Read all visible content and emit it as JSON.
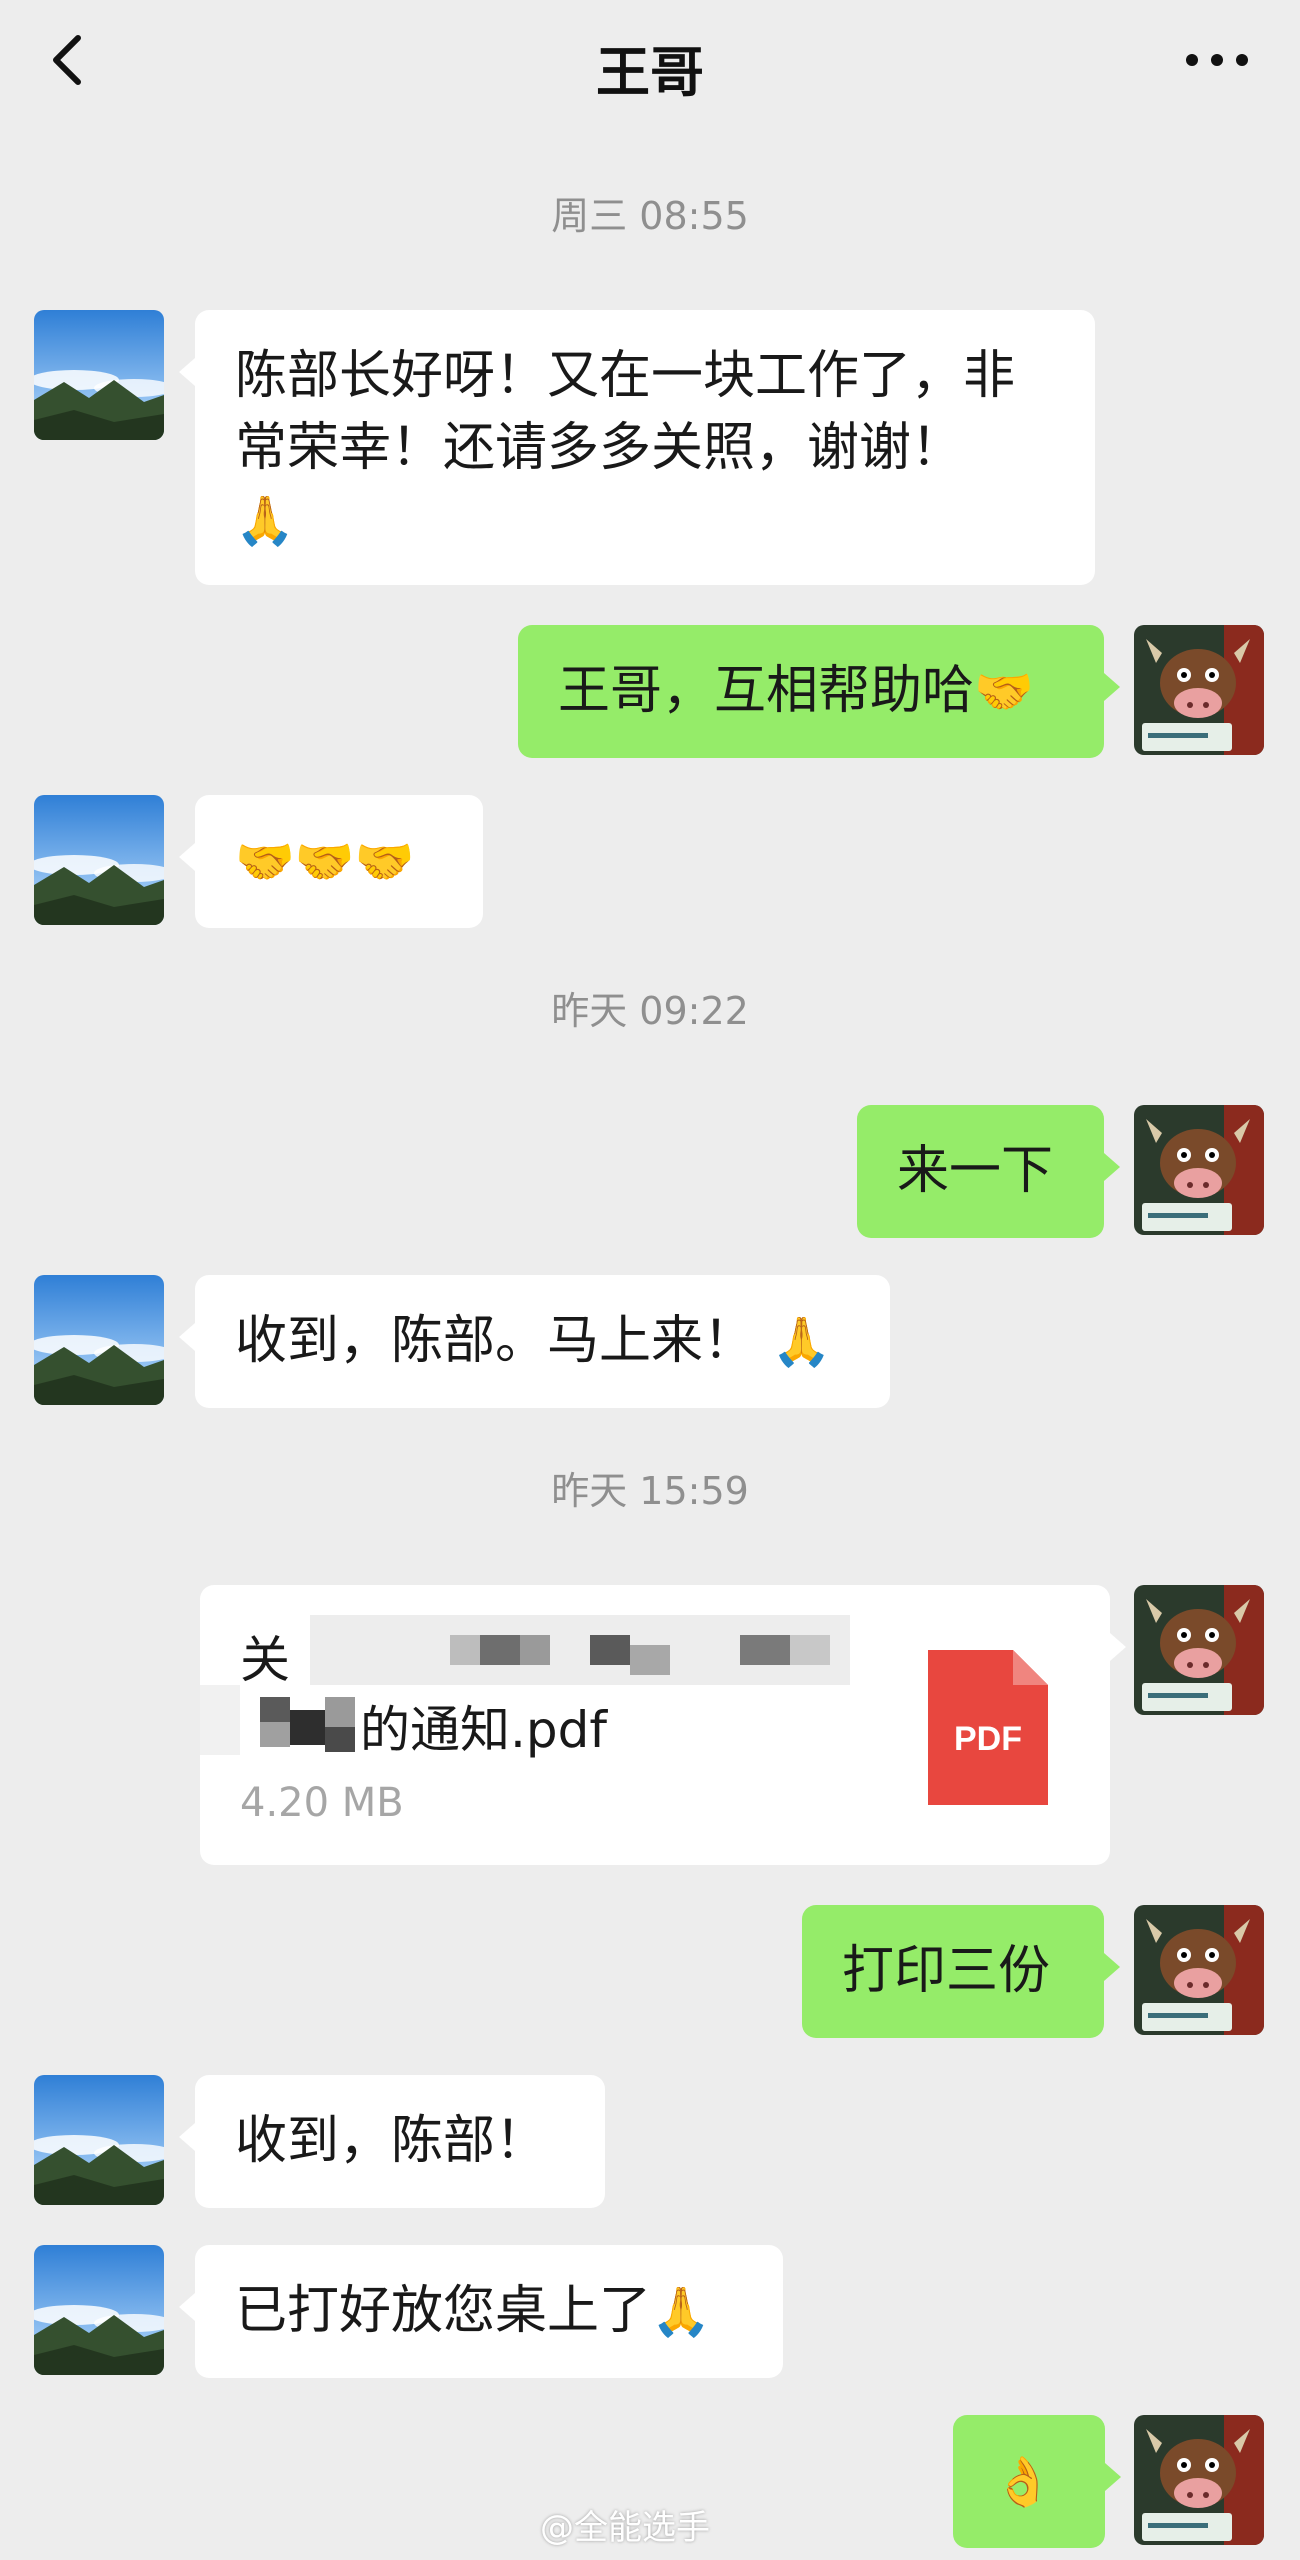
{
  "header": {
    "title": "王哥",
    "back_icon": "chevron-left-icon",
    "more_icon": "more-dots-icon"
  },
  "timestamps": [
    "周三 08:55",
    "昨天 09:22",
    "昨天 15:59"
  ],
  "messages": [
    {
      "side": "in",
      "text": "陈部长好呀！又在一块工作了，非常荣幸！还请多多关照，谢谢！",
      "emoji": "🙏"
    },
    {
      "side": "out",
      "text": "王哥，互相帮助哈",
      "emoji": "🤝"
    },
    {
      "side": "in",
      "text": "",
      "emoji": "🤝🤝🤝"
    },
    {
      "side": "out",
      "text": "来一下",
      "emoji": ""
    },
    {
      "side": "in",
      "text": "收到，陈部。马上来！",
      "emoji": "🙏"
    },
    {
      "side": "out",
      "text": "打印三份",
      "emoji": ""
    },
    {
      "side": "in",
      "text": "收到，陈部！",
      "emoji": ""
    },
    {
      "side": "in",
      "text": "已打好放您桌上了",
      "emoji": "🙏"
    },
    {
      "side": "out",
      "text": "",
      "emoji": "👌"
    }
  ],
  "file_message": {
    "name_prefix": "关",
    "name_suffix": "的通知.pdf",
    "size": "4.20 MB",
    "icon_label": "PDF"
  },
  "colors": {
    "background": "#ededed",
    "incoming_bubble": "#ffffff",
    "outgoing_bubble": "#95ec69",
    "timestamp": "#8f8f8f",
    "pdf_red": "#e8473f"
  },
  "watermark": "@全能选手"
}
